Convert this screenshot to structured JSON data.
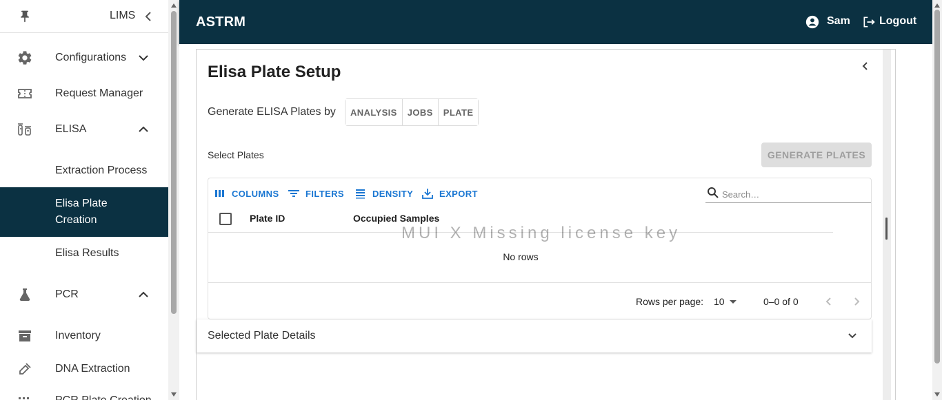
{
  "sidebar": {
    "title": "LIMS",
    "items": [
      {
        "label": "Configurations"
      },
      {
        "label": "Request Manager"
      },
      {
        "label": "ELISA"
      },
      {
        "label": "Extraction Process"
      },
      {
        "label": "Elisa Plate Creation"
      },
      {
        "label": "Elisa Results"
      },
      {
        "label": "PCR"
      },
      {
        "label": "Inventory"
      },
      {
        "label": "DNA Extraction"
      },
      {
        "label": "PCR Plate Creation"
      }
    ]
  },
  "header": {
    "brand": "ASTRM",
    "user": "Sam",
    "logout": "Logout"
  },
  "main": {
    "title": "Elisa Plate Setup",
    "generate_by_label": "Generate ELISA Plates by",
    "generate_by_options": [
      "ANALYSIS",
      "JOBS",
      "PLATE"
    ],
    "select_plates_label": "Select Plates",
    "generate_button": "GENERATE PLATES",
    "grid": {
      "toolbar": [
        "COLUMNS",
        "FILTERS",
        "DENSITY",
        "EXPORT"
      ],
      "search_placeholder": "Search…",
      "columns": [
        "Plate ID",
        "Occupied Samples"
      ],
      "watermark": "MUI X Missing license key",
      "empty_text": "No rows",
      "rows_per_page_label": "Rows per page:",
      "rows_per_page": "10",
      "range_text": "0–0 of 0"
    },
    "details_title": "Selected Plate Details"
  },
  "colors": {
    "primary_dark": "#0b3142",
    "link_blue": "#1976d2"
  }
}
